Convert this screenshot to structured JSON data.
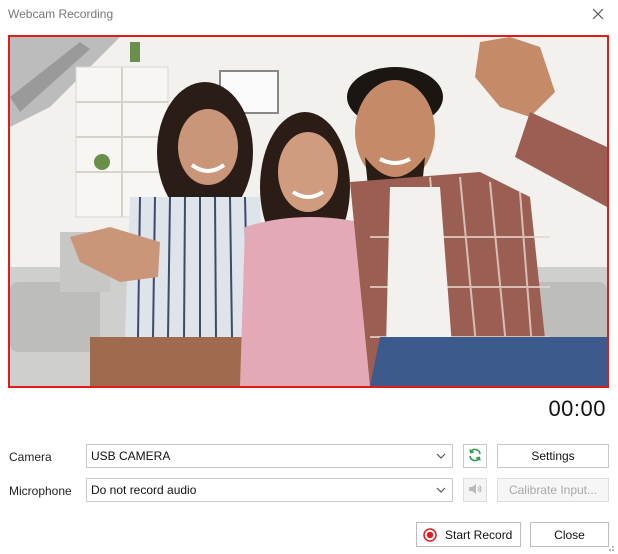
{
  "window": {
    "title": "Webcam Recording"
  },
  "preview": {
    "border_color": "#e01b1b"
  },
  "timer": "00:00",
  "camera": {
    "label": "Camera",
    "selected": "USB CAMERA",
    "settings_label": "Settings"
  },
  "microphone": {
    "label": "Microphone",
    "selected": "Do not record audio",
    "calibrate_label": "Calibrate Input..."
  },
  "actions": {
    "start_record_label": "Start Record",
    "close_label": "Close"
  },
  "colors": {
    "accent_red": "#e01b1b",
    "refresh_green": "#2e9e4a"
  },
  "icons": [
    "close-icon",
    "chevron-down-icon",
    "refresh-icon",
    "speaker-icon",
    "record-icon",
    "resize-grip-icon"
  ]
}
